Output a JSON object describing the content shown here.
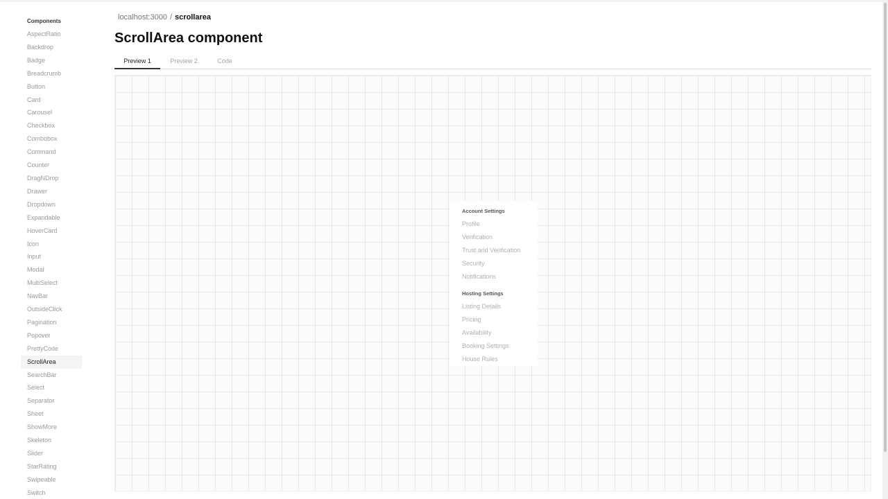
{
  "sidebar": {
    "heading": "Components",
    "items": [
      {
        "label": "AspectRatio"
      },
      {
        "label": "Backdrop"
      },
      {
        "label": "Badge"
      },
      {
        "label": "Breadcrumb"
      },
      {
        "label": "Button"
      },
      {
        "label": "Card"
      },
      {
        "label": "Carousel"
      },
      {
        "label": "Checkbox"
      },
      {
        "label": "Combobox"
      },
      {
        "label": "Command"
      },
      {
        "label": "Counter"
      },
      {
        "label": "DragNDrop"
      },
      {
        "label": "Drawer"
      },
      {
        "label": "Dropdown"
      },
      {
        "label": "Expandable"
      },
      {
        "label": "HoverCard"
      },
      {
        "label": "Icon"
      },
      {
        "label": "Input"
      },
      {
        "label": "Modal"
      },
      {
        "label": "MultiSelect"
      },
      {
        "label": "NavBar"
      },
      {
        "label": "OutsideClick"
      },
      {
        "label": "Pagination"
      },
      {
        "label": "Popover"
      },
      {
        "label": "PrettyCode"
      },
      {
        "label": "ScrollArea"
      },
      {
        "label": "SearchBar"
      },
      {
        "label": "Select"
      },
      {
        "label": "Separator"
      },
      {
        "label": "Sheet"
      },
      {
        "label": "ShowMore"
      },
      {
        "label": "Skeleton"
      },
      {
        "label": "Slider"
      },
      {
        "label": "StarRating"
      },
      {
        "label": "Swipeable"
      },
      {
        "label": "Switch"
      }
    ],
    "active_item": "ScrollArea"
  },
  "breadcrumb": {
    "root": "localhost:3000",
    "separator": "/",
    "current": "scrollarea"
  },
  "page": {
    "title": "ScrollArea component"
  },
  "tabs": [
    {
      "label": "Preview 1",
      "active": true
    },
    {
      "label": "Preview 2",
      "active": false
    },
    {
      "label": "Code",
      "active": false
    }
  ],
  "scroll_area": {
    "groups": [
      {
        "heading": "Account Settings",
        "items": [
          "Profile",
          "Verification",
          "Trust and Verification",
          "Security",
          "Notifications"
        ]
      },
      {
        "heading": "Hosting Settings",
        "items": [
          "Listing Details",
          "Pricing",
          "Availability",
          "Booking Settings",
          "House Rules"
        ]
      }
    ]
  },
  "colors": {
    "text_primary": "#111111",
    "text_muted": "#9a9a9a",
    "grid_line": "#e7e7e7",
    "active_tab_underline": "#333333"
  }
}
